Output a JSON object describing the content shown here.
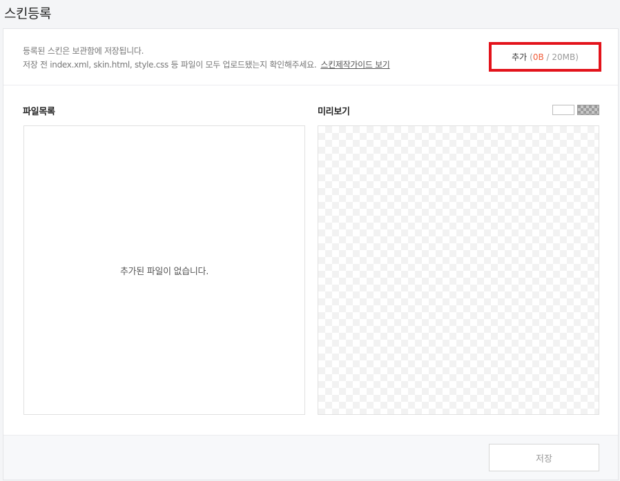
{
  "page": {
    "title": "스킨등록"
  },
  "info": {
    "line1": "등록된 스킨은 보관함에 저장됩니다.",
    "line2": "저장 전 index.xml, skin.html, style.css 등 파일이 모두 업로드됐는지 확인해주세요.",
    "guide_link": "스킨제작가이드 보기"
  },
  "add_button": {
    "label": "추가",
    "open_paren": "(",
    "used": "0B",
    "sep": " / ",
    "total": "20MB",
    "close_paren": ")"
  },
  "file_list": {
    "title": "파일목록",
    "empty_message": "추가된 파일이 없습니다."
  },
  "preview": {
    "title": "미리보기",
    "bg_options": [
      "white",
      "checkerboard"
    ]
  },
  "footer": {
    "save_label": "저장"
  },
  "colors": {
    "highlight_border": "#e3131b",
    "used_size": "#f05a36"
  }
}
